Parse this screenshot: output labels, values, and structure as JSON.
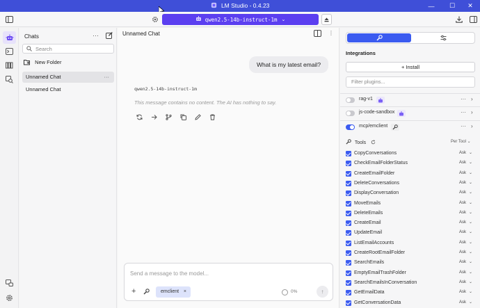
{
  "window": {
    "title": "LM Studio - 0.4.23",
    "minimize": "—",
    "maximize": "☐",
    "close": "✕"
  },
  "toolbar": {
    "model_name": "qwen2.5-14b-instruct-1m"
  },
  "sidebar": {
    "header": "Chats",
    "more": "···",
    "search_placeholder": "Search",
    "new_folder": "New Folder",
    "items": [
      {
        "label": "Unnamed Chat",
        "active": true,
        "more": "···"
      },
      {
        "label": "Unnamed Chat",
        "active": false
      }
    ]
  },
  "chat": {
    "title": "Unnamed Chat",
    "kebab": "⋮",
    "user_message": "What is my latest email?",
    "model_tag": "qwen2.5-14b-instruct-1m",
    "empty_message": "This message contains no content. The AI has nothing to say.",
    "composer_placeholder": "Send a message to the model...",
    "plus": "+",
    "chip_label": "emclient",
    "chip_close": "×",
    "context_label": "0%",
    "send_icon": "↑"
  },
  "right_panel": {
    "integrations_heading": "Integrations",
    "install_label": "+ Install",
    "filter_placeholder": "Filter plugins...",
    "plugins": [
      {
        "name": "rag-v1",
        "enabled": false
      },
      {
        "name": "js-code-sandbox",
        "enabled": false
      },
      {
        "name": "mcp/emclient",
        "enabled": true
      }
    ],
    "row_more": "···",
    "row_chevron": "›",
    "tools_label": "Tools",
    "per_tool_label": "Per Tool",
    "per_tool_chevron": "⌄",
    "tools": [
      {
        "name": "CopyConversations",
        "permission": "Ask",
        "checked": true
      },
      {
        "name": "CheckEmailFolderStatus",
        "permission": "Ask",
        "checked": true
      },
      {
        "name": "CreateEmailFolder",
        "permission": "Ask",
        "checked": true
      },
      {
        "name": "DeleteConversations",
        "permission": "Ask",
        "checked": true
      },
      {
        "name": "DisplayConversation",
        "permission": "Ask",
        "checked": true
      },
      {
        "name": "MoveEmails",
        "permission": "Ask",
        "checked": true
      },
      {
        "name": "DeleteEmails",
        "permission": "Ask",
        "checked": true
      },
      {
        "name": "CreateEmail",
        "permission": "Ask",
        "checked": true
      },
      {
        "name": "UpdateEmail",
        "permission": "Ask",
        "checked": true
      },
      {
        "name": "ListEmailAccounts",
        "permission": "Ask",
        "checked": true
      },
      {
        "name": "CreateRootEmailFolder",
        "permission": "Ask",
        "checked": true
      },
      {
        "name": "SearchEmails",
        "permission": "Ask",
        "checked": true
      },
      {
        "name": "EmptyEmailTrashFolder",
        "permission": "Ask",
        "checked": true
      },
      {
        "name": "SearchEmailsInConversation",
        "permission": "Ask",
        "checked": true
      },
      {
        "name": "GetEmailData",
        "permission": "Ask",
        "checked": true
      },
      {
        "name": "GetConversationData",
        "permission": "Ask",
        "checked": true
      }
    ],
    "tool_chevron": "⌄"
  },
  "colors": {
    "titlebar": "#3f4fd8",
    "model_select": "#5b3ff0",
    "accent": "#3b5bf0",
    "chip": "#dde3fb"
  }
}
